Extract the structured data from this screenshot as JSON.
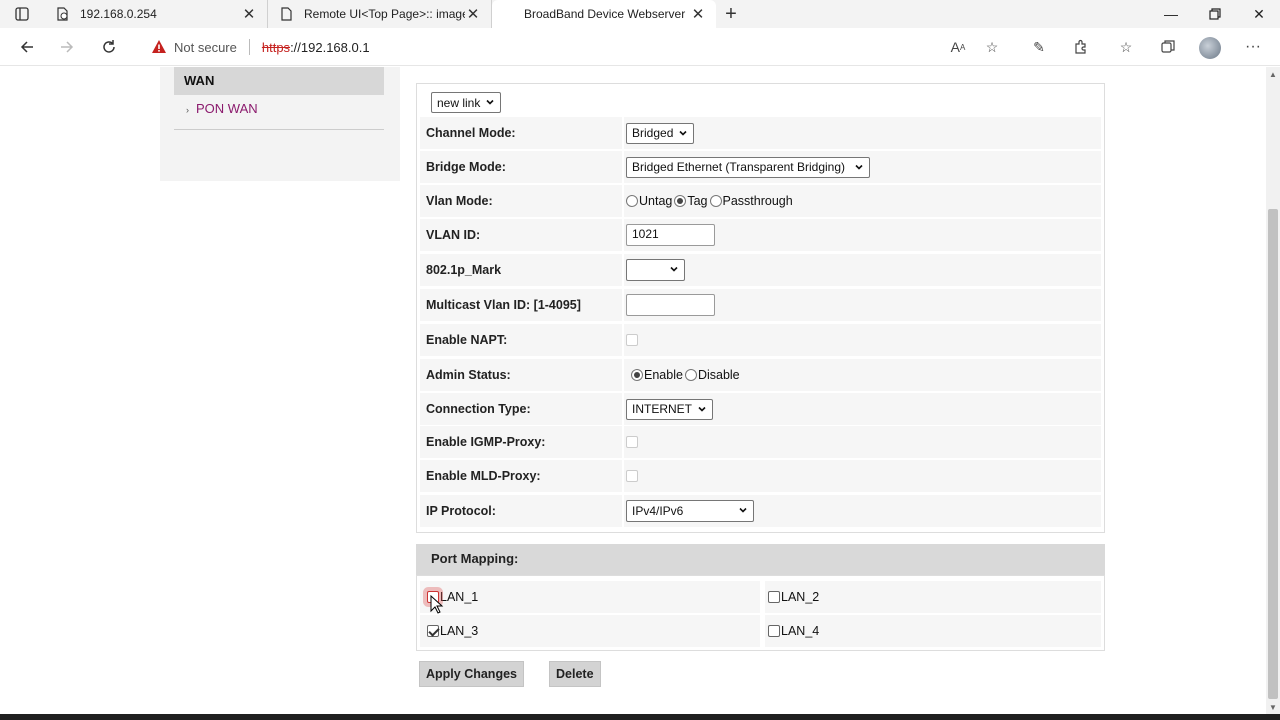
{
  "browser": {
    "tabs": [
      {
        "title": "192.168.0.254",
        "active": false
      },
      {
        "title": "Remote UI<Top Page>:: imageR",
        "active": false
      },
      {
        "title": "BroadBand Device Webserver",
        "active": true
      }
    ],
    "security_label": "Not secure",
    "url_scheme": "https",
    "url_rest": "://192.168.0.1"
  },
  "sidebar": {
    "heading": "WAN",
    "items": [
      {
        "label": "PON WAN"
      }
    ]
  },
  "form": {
    "link_select": "new link",
    "channel_mode": {
      "label": "Channel Mode:",
      "value": "Bridged"
    },
    "bridge_mode": {
      "label": "Bridge Mode:",
      "value": "Bridged Ethernet (Transparent Bridging)"
    },
    "vlan_mode": {
      "label": "Vlan Mode:",
      "options": [
        "Untag",
        "Tag",
        "Passthrough"
      ],
      "selected": "Tag"
    },
    "vlan_id": {
      "label": "VLAN ID:",
      "value": "1021"
    },
    "mark": {
      "label": "802.1p_Mark",
      "value": ""
    },
    "mcast_vlan": {
      "label": "Multicast Vlan ID: [1-4095]",
      "value": ""
    },
    "napt": {
      "label": "Enable NAPT:"
    },
    "admin_status": {
      "label": "Admin Status:",
      "options": [
        "Enable",
        "Disable"
      ],
      "selected": "Enable"
    },
    "connection_type": {
      "label": "Connection Type:",
      "value": "INTERNET"
    },
    "igmp": {
      "label": "Enable IGMP-Proxy:"
    },
    "mld": {
      "label": "Enable MLD-Proxy:"
    },
    "ip_protocol": {
      "label": "IP Protocol:",
      "value": "IPv4/IPv6"
    }
  },
  "port_mapping": {
    "heading": "Port Mapping:",
    "ports": [
      {
        "label": "LAN_1",
        "checked": false
      },
      {
        "label": "LAN_2",
        "checked": false
      },
      {
        "label": "LAN_3",
        "checked": true
      },
      {
        "label": "LAN_4",
        "checked": false
      }
    ]
  },
  "buttons": {
    "apply": "Apply Changes",
    "delete": "Delete"
  }
}
